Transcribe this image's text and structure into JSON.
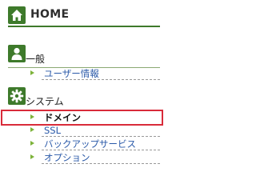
{
  "home": {
    "label": "HOME",
    "icon": "house-icon"
  },
  "sections": [
    {
      "label": "一般",
      "icon": "person-icon",
      "items": [
        {
          "label": "ユーザー情報"
        }
      ]
    },
    {
      "label": "システム",
      "icon": "gear-icon",
      "items": [
        {
          "label": "ドメイン",
          "selected": true
        },
        {
          "label": "SSL"
        },
        {
          "label": "バックアップサービス"
        },
        {
          "label": "オプション"
        }
      ]
    }
  ],
  "colors": {
    "accent_green": "#3e7a2b",
    "arrow_green": "#7db33a",
    "link_blue": "#2a59a8",
    "selected_border": "#d92b3a"
  }
}
